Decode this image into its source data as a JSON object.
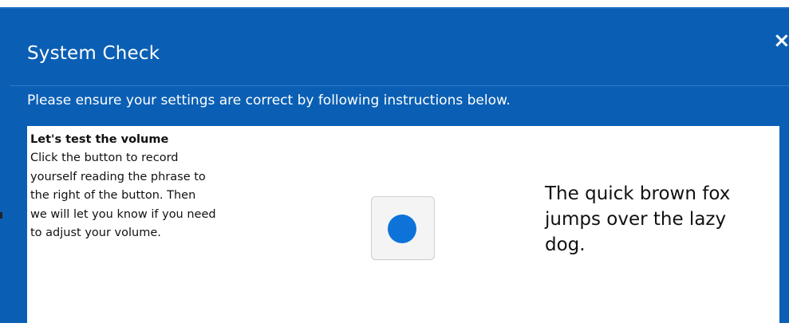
{
  "dialog": {
    "title": "System Check",
    "close_label": "×",
    "instructions": "Please ensure your settings are correct by following instructions below."
  },
  "volume_test": {
    "heading": "Let's test the volume",
    "description_lines": [
      "Click the button to record",
      "yourself reading the phrase to",
      "the right of the button. Then",
      "we will let you know if you need",
      "to adjust your volume."
    ],
    "record_button_icon": "record-icon",
    "phrase": "The quick brown fox jumps over the lazy dog."
  },
  "colors": {
    "dialog_background": "#0a5fb4",
    "panel_background": "#ffffff",
    "record_dot": "#0e73d8"
  }
}
